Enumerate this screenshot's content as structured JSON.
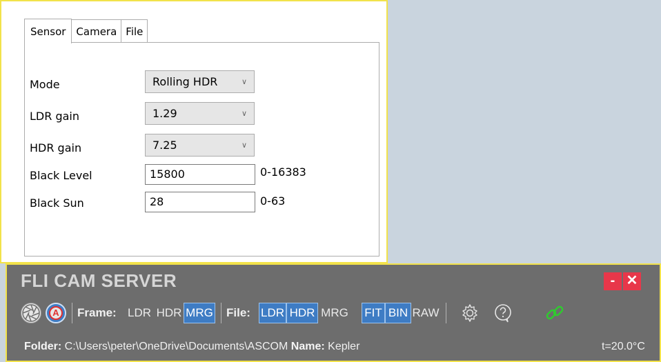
{
  "settings": {
    "tabs": [
      "Sensor",
      "Camera",
      "File"
    ],
    "active_tab": "Sensor",
    "mode": {
      "label": "Mode",
      "value": "Rolling HDR"
    },
    "ldr_gain": {
      "label": "LDR gain",
      "value": "1.29"
    },
    "hdr_gain": {
      "label": "HDR gain",
      "value": "7.25"
    },
    "black_level": {
      "label": "Black Level",
      "value": "15800",
      "range": "0-16383"
    },
    "black_sun": {
      "label": "Black Sun",
      "value": "28",
      "range": "0-63"
    }
  },
  "server": {
    "title": "FLI CAM SERVER",
    "minimize_label": "-",
    "close_label": "✕",
    "auto_label": "A",
    "frame_label": "Frame:",
    "frame_options": [
      "LDR",
      "HDR",
      "MRG"
    ],
    "frame_selected": "MRG",
    "file_label": "File:",
    "file_options": [
      "LDR",
      "HDR",
      "MRG"
    ],
    "file_selected": [
      "LDR",
      "HDR"
    ],
    "format_options": [
      "FIT",
      "BIN",
      "RAW"
    ],
    "format_selected": [
      "FIT",
      "BIN"
    ],
    "folder_label": "Folder:",
    "folder_value": "C:\\Users\\peter\\OneDrive\\Documents\\ASCOM",
    "name_label": "Name:",
    "name_value": "Kepler",
    "temperature": "t=20.0°C",
    "colors": {
      "accent": "#3e7cc4",
      "close": "#e8374a",
      "link": "#2ecc2e",
      "border": "#f2e24a"
    }
  }
}
